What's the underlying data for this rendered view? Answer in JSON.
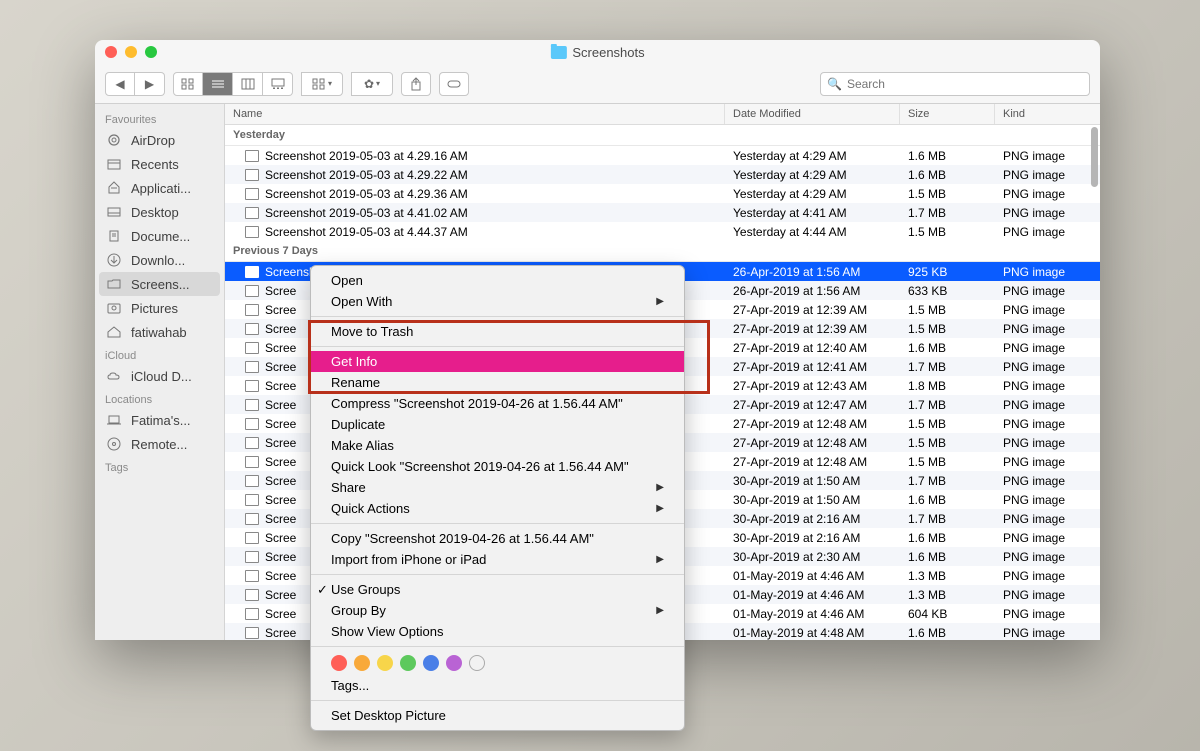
{
  "window": {
    "title": "Screenshots"
  },
  "search": {
    "placeholder": "Search"
  },
  "sidebar": {
    "sections": [
      {
        "label": "Favourites",
        "items": [
          {
            "icon": "airdrop",
            "label": "AirDrop"
          },
          {
            "icon": "recents",
            "label": "Recents"
          },
          {
            "icon": "apps",
            "label": "Applicati..."
          },
          {
            "icon": "desktop",
            "label": "Desktop"
          },
          {
            "icon": "docs",
            "label": "Docume..."
          },
          {
            "icon": "downloads",
            "label": "Downlo..."
          },
          {
            "icon": "folder",
            "label": "Screens...",
            "selected": true
          },
          {
            "icon": "pictures",
            "label": "Pictures"
          },
          {
            "icon": "home",
            "label": "fatiwahab"
          }
        ]
      },
      {
        "label": "iCloud",
        "items": [
          {
            "icon": "cloud",
            "label": "iCloud D..."
          }
        ]
      },
      {
        "label": "Locations",
        "items": [
          {
            "icon": "laptop",
            "label": "Fatima's..."
          },
          {
            "icon": "disc",
            "label": "Remote..."
          }
        ]
      },
      {
        "label": "Tags",
        "items": []
      }
    ]
  },
  "columns": {
    "name": "Name",
    "date": "Date Modified",
    "size": "Size",
    "kind": "Kind"
  },
  "groups": [
    {
      "label": "Yesterday",
      "rows": [
        {
          "name": "Screenshot 2019-05-03 at 4.29.16 AM",
          "date": "Yesterday at 4:29 AM",
          "size": "1.6 MB",
          "kind": "PNG image"
        },
        {
          "name": "Screenshot 2019-05-03 at 4.29.22 AM",
          "date": "Yesterday at 4:29 AM",
          "size": "1.6 MB",
          "kind": "PNG image"
        },
        {
          "name": "Screenshot 2019-05-03 at 4.29.36 AM",
          "date": "Yesterday at 4:29 AM",
          "size": "1.5 MB",
          "kind": "PNG image"
        },
        {
          "name": "Screenshot 2019-05-03 at 4.41.02 AM",
          "date": "Yesterday at 4:41 AM",
          "size": "1.7 MB",
          "kind": "PNG image"
        },
        {
          "name": "Screenshot 2019-05-03 at 4.44.37 AM",
          "date": "Yesterday at 4:44 AM",
          "size": "1.5 MB",
          "kind": "PNG image"
        }
      ]
    },
    {
      "label": "Previous 7 Days",
      "rows": [
        {
          "name": "Screenshot 2019-04-26 at 1.56.44 AM",
          "date": "26-Apr-2019 at 1:56 AM",
          "size": "925 KB",
          "kind": "PNG image",
          "selected": true
        },
        {
          "name": "Scree",
          "date": "26-Apr-2019 at 1:56 AM",
          "size": "633 KB",
          "kind": "PNG image"
        },
        {
          "name": "Scree",
          "date": "27-Apr-2019 at 12:39 AM",
          "size": "1.5 MB",
          "kind": "PNG image"
        },
        {
          "name": "Scree",
          "date": "27-Apr-2019 at 12:39 AM",
          "size": "1.5 MB",
          "kind": "PNG image"
        },
        {
          "name": "Scree",
          "date": "27-Apr-2019 at 12:40 AM",
          "size": "1.6 MB",
          "kind": "PNG image"
        },
        {
          "name": "Scree",
          "date": "27-Apr-2019 at 12:41 AM",
          "size": "1.7 MB",
          "kind": "PNG image"
        },
        {
          "name": "Scree",
          "date": "27-Apr-2019 at 12:43 AM",
          "size": "1.8 MB",
          "kind": "PNG image"
        },
        {
          "name": "Scree",
          "date": "27-Apr-2019 at 12:47 AM",
          "size": "1.7 MB",
          "kind": "PNG image"
        },
        {
          "name": "Scree",
          "date": "27-Apr-2019 at 12:48 AM",
          "size": "1.5 MB",
          "kind": "PNG image"
        },
        {
          "name": "Scree",
          "date": "27-Apr-2019 at 12:48 AM",
          "size": "1.5 MB",
          "kind": "PNG image"
        },
        {
          "name": "Scree",
          "date": "27-Apr-2019 at 12:48 AM",
          "size": "1.5 MB",
          "kind": "PNG image"
        },
        {
          "name": "Scree",
          "date": "30-Apr-2019 at 1:50 AM",
          "size": "1.7 MB",
          "kind": "PNG image"
        },
        {
          "name": "Scree",
          "date": "30-Apr-2019 at 1:50 AM",
          "size": "1.6 MB",
          "kind": "PNG image"
        },
        {
          "name": "Scree",
          "date": "30-Apr-2019 at 2:16 AM",
          "size": "1.7 MB",
          "kind": "PNG image"
        },
        {
          "name": "Scree",
          "date": "30-Apr-2019 at 2:16 AM",
          "size": "1.6 MB",
          "kind": "PNG image"
        },
        {
          "name": "Scree",
          "date": "30-Apr-2019 at 2:30 AM",
          "size": "1.6 MB",
          "kind": "PNG image"
        },
        {
          "name": "Scree",
          "date": "01-May-2019 at 4:46 AM",
          "size": "1.3 MB",
          "kind": "PNG image"
        },
        {
          "name": "Scree",
          "date": "01-May-2019 at 4:46 AM",
          "size": "1.3 MB",
          "kind": "PNG image"
        },
        {
          "name": "Scree",
          "date": "01-May-2019 at 4:46 AM",
          "size": "604 KB",
          "kind": "PNG image"
        },
        {
          "name": "Scree",
          "date": "01-May-2019 at 4:48 AM",
          "size": "1.6 MB",
          "kind": "PNG image"
        }
      ]
    }
  ],
  "contextmenu": {
    "items": [
      {
        "label": "Open"
      },
      {
        "label": "Open With",
        "submenu": true
      },
      {
        "sep": true
      },
      {
        "label": "Move to Trash"
      },
      {
        "sep": true
      },
      {
        "label": "Get Info",
        "highlighted": true
      },
      {
        "label": "Rename"
      },
      {
        "label": "Compress \"Screenshot 2019-04-26 at 1.56.44 AM\""
      },
      {
        "label": "Duplicate"
      },
      {
        "label": "Make Alias"
      },
      {
        "label": "Quick Look \"Screenshot 2019-04-26 at 1.56.44 AM\""
      },
      {
        "label": "Share",
        "submenu": true
      },
      {
        "label": "Quick Actions",
        "submenu": true
      },
      {
        "sep": true
      },
      {
        "label": "Copy \"Screenshot 2019-04-26 at 1.56.44 AM\""
      },
      {
        "label": "Import from iPhone or iPad",
        "submenu": true
      },
      {
        "sep": true
      },
      {
        "label": "Use Groups",
        "checked": true
      },
      {
        "label": "Group By",
        "submenu": true
      },
      {
        "label": "Show View Options"
      },
      {
        "sep": true
      },
      {
        "tags": true
      },
      {
        "label": "Tags..."
      },
      {
        "sep": true
      },
      {
        "label": "Set Desktop Picture"
      }
    ],
    "tagColors": [
      "#ff5f57",
      "#f8a93a",
      "#f7d54a",
      "#5dc95d",
      "#4a7fe7",
      "#b963d4"
    ]
  }
}
